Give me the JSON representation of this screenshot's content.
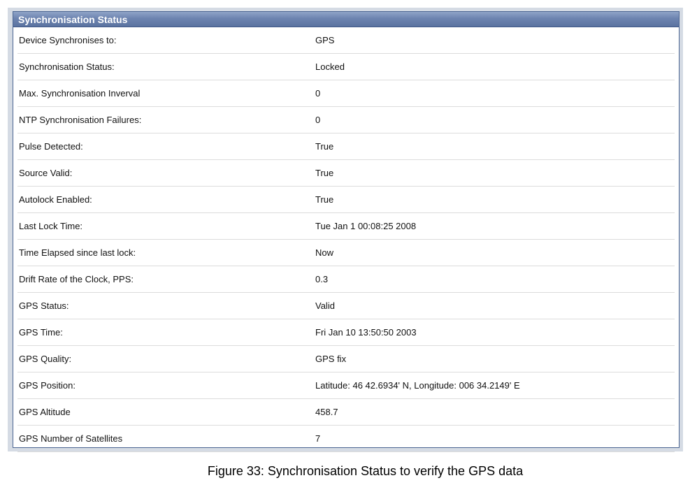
{
  "panel": {
    "title": "Synchronisation Status"
  },
  "rows": [
    {
      "label": "Device Synchronises to:",
      "value": "GPS"
    },
    {
      "label": "Synchronisation Status:",
      "value": "Locked"
    },
    {
      "label": "Max. Synchronisation Inverval",
      "value": "0"
    },
    {
      "label": "NTP Synchronisation Failures:",
      "value": "0"
    },
    {
      "label": "Pulse Detected:",
      "value": "True"
    },
    {
      "label": "Source Valid:",
      "value": "True"
    },
    {
      "label": "Autolock Enabled:",
      "value": "True"
    },
    {
      "label": "Last Lock Time:",
      "value": "Tue Jan 1 00:08:25 2008"
    },
    {
      "label": "Time Elapsed since last lock:",
      "value": "Now"
    },
    {
      "label": "Drift Rate of the Clock, PPS:",
      "value": "0.3"
    },
    {
      "label": "GPS Status:",
      "value": "Valid"
    },
    {
      "label": "GPS Time:",
      "value": "Fri Jan 10 13:50:50 2003"
    },
    {
      "label": "GPS Quality:",
      "value": "GPS fix"
    },
    {
      "label": "GPS Position:",
      "value": "Latitude: 46 42.6934' N, Longitude: 006 34.2149' E"
    },
    {
      "label": "GPS Altitude",
      "value": "458.7"
    },
    {
      "label": "GPS Number of Satellites",
      "value": "7"
    }
  ],
  "caption": "Figure 33: Synchronisation Status to verify the GPS data",
  "colors": {
    "header_bg": "#6d84b0",
    "frame_bg": "#d5dbe4",
    "row_divider": "#dcdcdc"
  }
}
